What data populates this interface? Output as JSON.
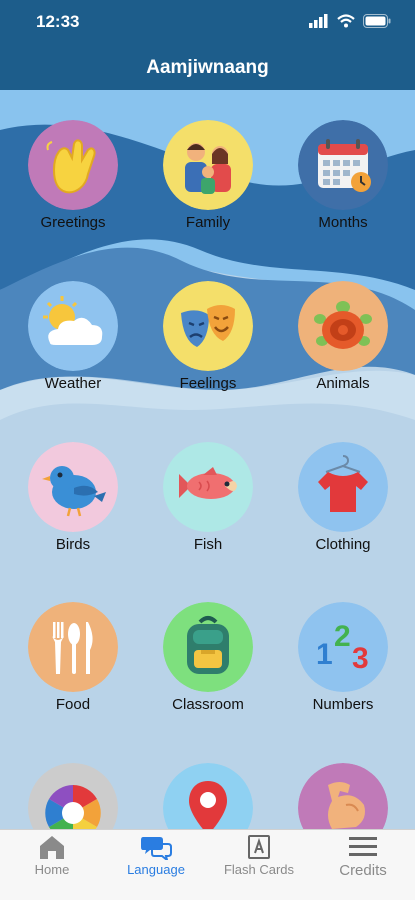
{
  "status": {
    "time": "12:33"
  },
  "nav": {
    "title": "Aamjiwnaang"
  },
  "categories": [
    {
      "label": "Greetings",
      "icon": "waving-hand-icon",
      "color": "#c07ab8"
    },
    {
      "label": "Family",
      "icon": "family-icon",
      "color": "#f4df6a"
    },
    {
      "label": "Months",
      "icon": "calendar-icon",
      "color": "#3f6fa8"
    },
    {
      "label": "Weather",
      "icon": "sun-cloud-icon",
      "color": "#8fc3ef"
    },
    {
      "label": "Feelings",
      "icon": "theater-masks-icon",
      "color": "#f4df6a"
    },
    {
      "label": "Animals",
      "icon": "turtle-icon",
      "color": "#efb27a"
    },
    {
      "label": "Birds",
      "icon": "bird-icon",
      "color": "#f2c9dd"
    },
    {
      "label": "Fish",
      "icon": "fish-icon",
      "color": "#aee8e6"
    },
    {
      "label": "Clothing",
      "icon": "shirt-icon",
      "color": "#8fc3ef"
    },
    {
      "label": "Food",
      "icon": "cutlery-icon",
      "color": "#efb27a"
    },
    {
      "label": "Classroom",
      "icon": "backpack-icon",
      "color": "#7ee07e"
    },
    {
      "label": "Numbers",
      "icon": "numbers-icon",
      "color": "#8fc3ef"
    },
    {
      "label": "",
      "icon": "color-wheel-icon",
      "color": "#cccccc"
    },
    {
      "label": "",
      "icon": "map-pin-icon",
      "color": "#8fd1f2"
    },
    {
      "label": "",
      "icon": "muscle-arm-icon",
      "color": "#c07ab8"
    }
  ],
  "tabs": [
    {
      "label": "Home",
      "icon": "home-icon",
      "active": false
    },
    {
      "label": "Language",
      "icon": "chat-bubbles-icon",
      "active": true
    },
    {
      "label": "Flash Cards",
      "icon": "flash-card-icon",
      "active": false
    },
    {
      "label": "Credits",
      "icon": "list-icon",
      "active": false
    }
  ]
}
